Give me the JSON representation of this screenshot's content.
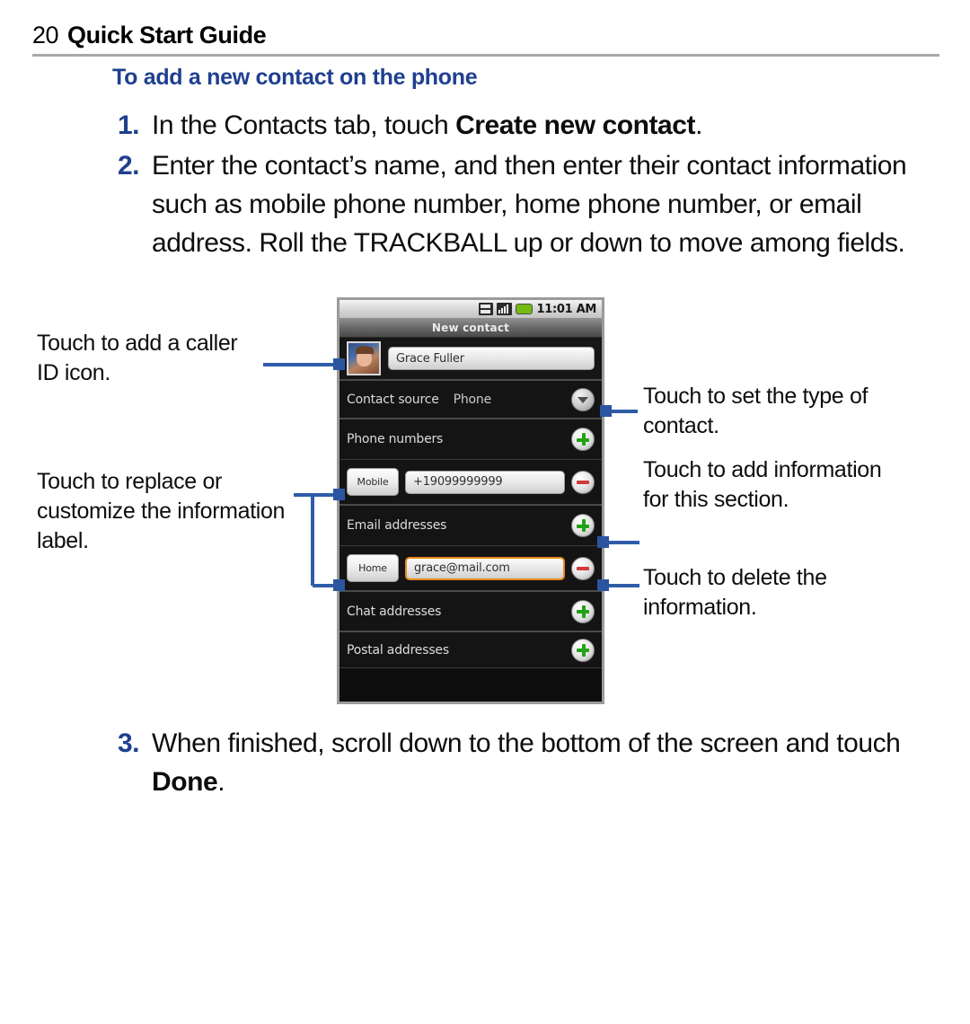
{
  "header": {
    "page_number": "20",
    "title": "Quick Start Guide"
  },
  "section_heading": "To add a new contact on the phone",
  "steps": [
    {
      "number": "1.",
      "text_before": "In the Contacts tab, touch ",
      "bold": "Create new contact",
      "text_after": "."
    },
    {
      "number": "2.",
      "text_before": "Enter the contact’s name, and then enter their contact information such as mobile phone number, home phone number, or email address. Roll the TRACKBALL up or down to move among fields.",
      "bold": "",
      "text_after": ""
    }
  ],
  "step3": {
    "number": "3.",
    "text_before": "When finished, scroll down to the bottom of the screen and touch ",
    "bold": "Done",
    "text_after": "."
  },
  "phone": {
    "status_bar": {
      "time": "11:01 AM",
      "icons": [
        "data-transfer-icon",
        "signal-bars-icon",
        "battery-icon"
      ]
    },
    "title_bar": "New contact",
    "name_row": {
      "avatar": "contact-photo",
      "name_value": "Grace Fuller"
    },
    "contact_source": {
      "label": "Contact source",
      "value": "Phone",
      "control": "chevron-down-icon"
    },
    "sections": [
      {
        "label": "Phone numbers",
        "add": "plus-icon",
        "entry": {
          "type_label": "Mobile",
          "value": "+19099999999",
          "focused": false,
          "remove": "minus-icon"
        }
      },
      {
        "label": "Email addresses",
        "add": "plus-icon",
        "entry": {
          "type_label": "Home",
          "value": "grace@mail.com",
          "focused": true,
          "remove": "minus-icon"
        }
      },
      {
        "label": "Chat addresses",
        "add": "plus-icon",
        "entry": null
      },
      {
        "label": "Postal addresses",
        "add": "plus-icon",
        "entry": null
      }
    ]
  },
  "annotations": {
    "caller_id": "Touch to add a caller ID icon.",
    "replace_label": "Touch to replace or customize the information label.",
    "set_type": "Touch to set the type of contact.",
    "add_info": "Touch to add information for this section.",
    "delete_info": "Touch to delete the information."
  },
  "colors": {
    "accent_blue": "#1f3f8f",
    "leader_blue": "#2f5ca8",
    "focus_orange": "#e8891d",
    "plus_green": "#22a216",
    "minus_red": "#d23a3a",
    "battery_green": "#76bb12"
  }
}
